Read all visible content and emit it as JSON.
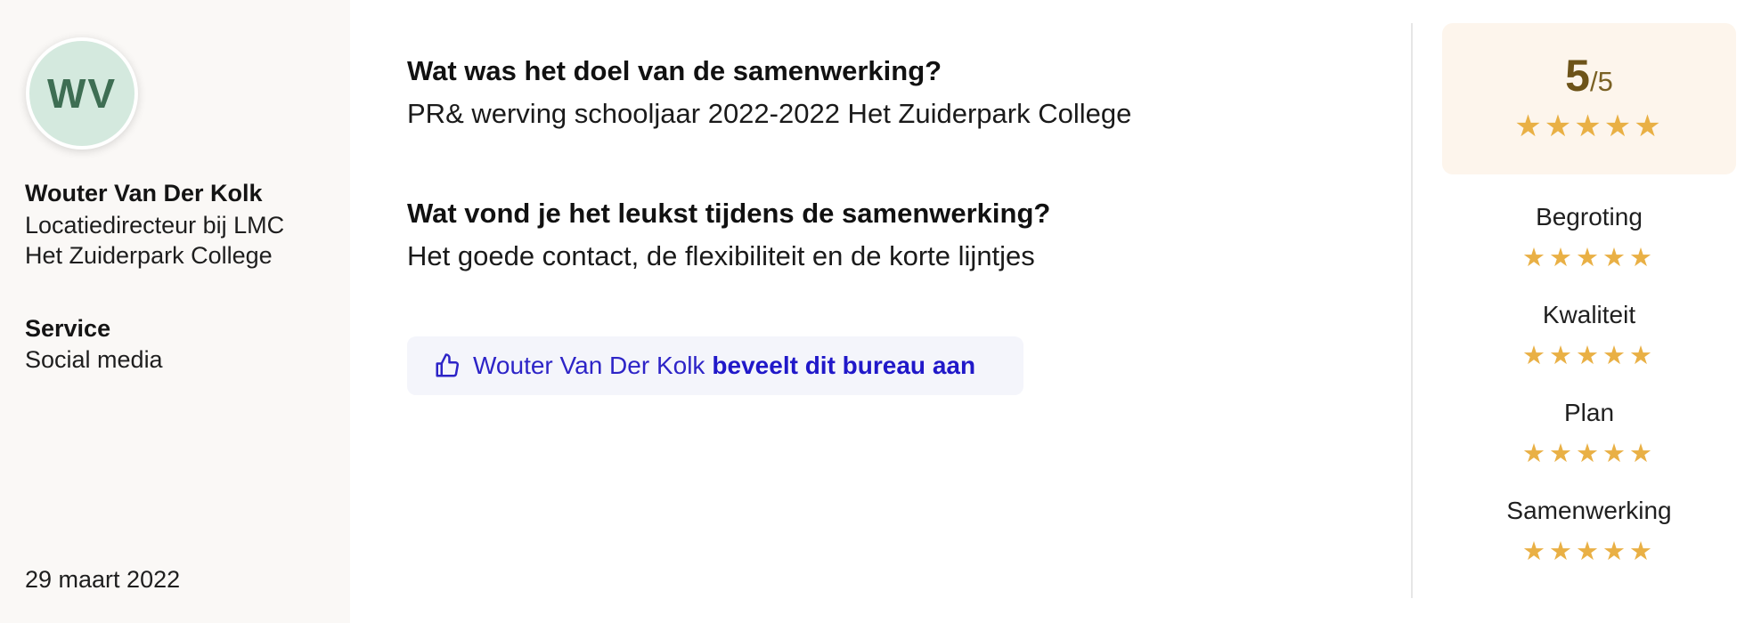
{
  "reviewer": {
    "initials": "WV",
    "name": "Wouter Van Der Kolk",
    "role": "Locatiedirecteur bij LMC Het Zuiderpark College",
    "service_label": "Service",
    "service_value": "Social media",
    "date": "29 maart 2022"
  },
  "qa": [
    {
      "question": "Wat was het doel van de samenwerking?",
      "answer": "PR& werving schooljaar 2022-2022 Het Zuiderpark College"
    },
    {
      "question": "Wat vond je het leukst tijdens de samenwerking?",
      "answer": "Het goede contact, de flexibiliteit en de korte lijntjes"
    }
  ],
  "recommendation": {
    "name": "Wouter Van Der Kolk",
    "text": "beveelt dit bureau aan",
    "icon": "thumbs-up-icon"
  },
  "score": {
    "value": "5",
    "max": "/5",
    "stars": "★★★★★",
    "rating": 5
  },
  "ratings": [
    {
      "label": "Begroting",
      "stars": "★★★★★",
      "value": 5
    },
    {
      "label": "Kwaliteit",
      "stars": "★★★★★",
      "value": 5
    },
    {
      "label": "Plan",
      "stars": "★★★★★",
      "value": 5
    },
    {
      "label": "Samenwerking",
      "stars": "★★★★★",
      "value": 5
    }
  ],
  "colors": {
    "left_panel_bg": "#faf8f6",
    "avatar_bg": "#d4e9de",
    "avatar_text": "#3e6e53",
    "star": "#e9b045",
    "score_bg": "#fdf5ec",
    "recommend_text": "#2d24c7",
    "recommend_bg": "#f4f5fb"
  }
}
